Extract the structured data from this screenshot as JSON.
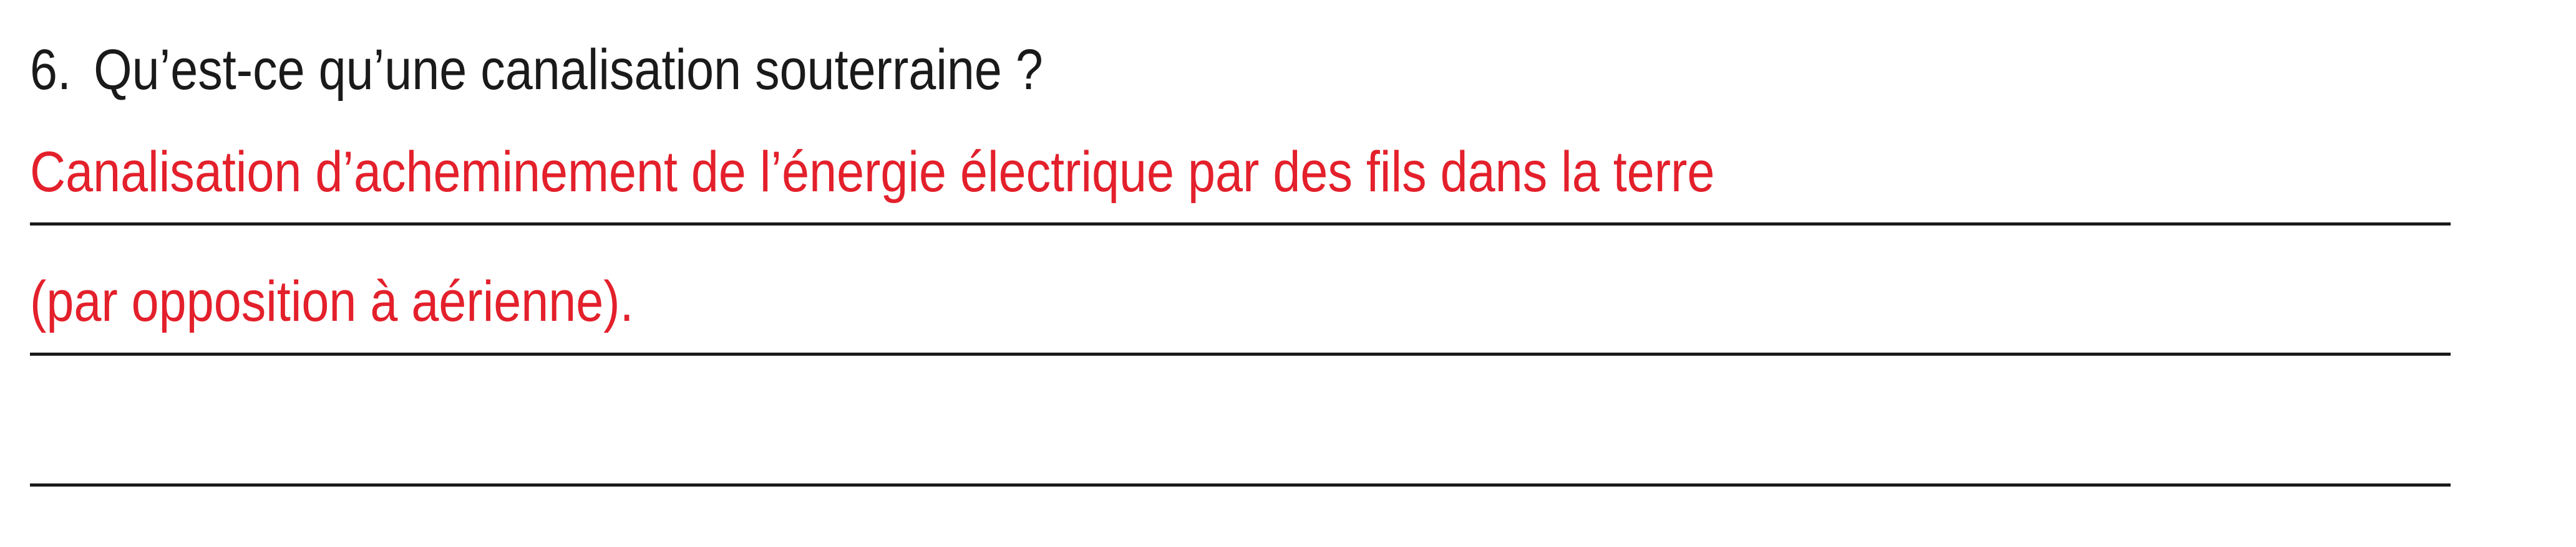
{
  "question": {
    "number": "6.",
    "text": "Qu’est-ce qu’une canalisation souterraine ?"
  },
  "answer": {
    "lines": [
      "Canalisation d’acheminement de l’énergie électrique par des fils dans la terre",
      "(par opposition à aérienne)."
    ]
  },
  "colors": {
    "question_text": "#1a1a1a",
    "answer_text": "#e3202b",
    "rule": "#1a1a1a"
  }
}
